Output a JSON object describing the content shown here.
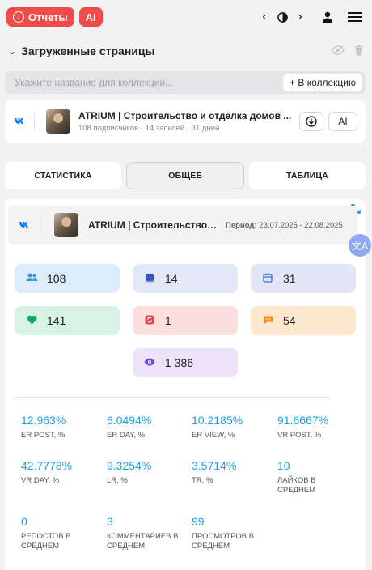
{
  "topbar": {
    "reports_label": "Отчеты",
    "ai_label": "AI"
  },
  "loaded": {
    "title": "Загруженные страницы",
    "collection_placeholder": "Укажите название для коллекции...",
    "collection_button": "+ В коллекцию"
  },
  "page": {
    "network": "VK",
    "title": "ATRIUM | Строительство и отделка домов ...",
    "subtitle": "108 подписчиков · 14 записей · 31 дней",
    "ai_label": "AI"
  },
  "tabs": [
    "СТАТИСТИКА",
    "ОБЩЕЕ",
    "ТАБЛИЦА"
  ],
  "summary": {
    "network": "VK",
    "title": "ATRIUM | Строительство и...",
    "period_label": "Период:",
    "period_value": "23.07.2025 - 22.08.2025"
  },
  "stats": [
    {
      "icon": "users-icon",
      "value": "108",
      "color": "#dcecfb"
    },
    {
      "icon": "posts-icon",
      "value": "14",
      "color": "#e3e8f6"
    },
    {
      "icon": "calendar-icon",
      "value": "31",
      "color": "#e3e6f6"
    },
    {
      "icon": "heart-icon",
      "value": "141",
      "color": "#d6f3e3"
    },
    {
      "icon": "repost-icon",
      "value": "1",
      "color": "#fbdede"
    },
    {
      "icon": "comment-icon",
      "value": "54",
      "color": "#fde7cf"
    },
    {
      "icon": "eye-icon",
      "value": "1 386",
      "color": "#ece3f9"
    }
  ],
  "metrics": [
    {
      "value": "12.963%",
      "label": "ER POST, %"
    },
    {
      "value": "6.0494%",
      "label": "ER DAY, %"
    },
    {
      "value": "10.2185%",
      "label": "ER VIEW, %"
    },
    {
      "value": "91.6667%",
      "label": "VR POST, %"
    },
    {
      "value": "42.7778%",
      "label": "VR DAY, %"
    },
    {
      "value": "9.3254%",
      "label": "LR, %"
    },
    {
      "value": "3.5714%",
      "label": "TR, %"
    },
    {
      "value": "10",
      "label": "ЛАЙКОВ В СРЕДНЕМ"
    },
    {
      "value": "0",
      "label": "РЕПОСТОВ В СРЕДНЕМ"
    },
    {
      "value": "3",
      "label": "КОММЕНТАРИЕВ В СРЕДНЕМ"
    },
    {
      "value": "99",
      "label": "ПРОСМОТРОВ В СРЕДНЕМ"
    }
  ]
}
